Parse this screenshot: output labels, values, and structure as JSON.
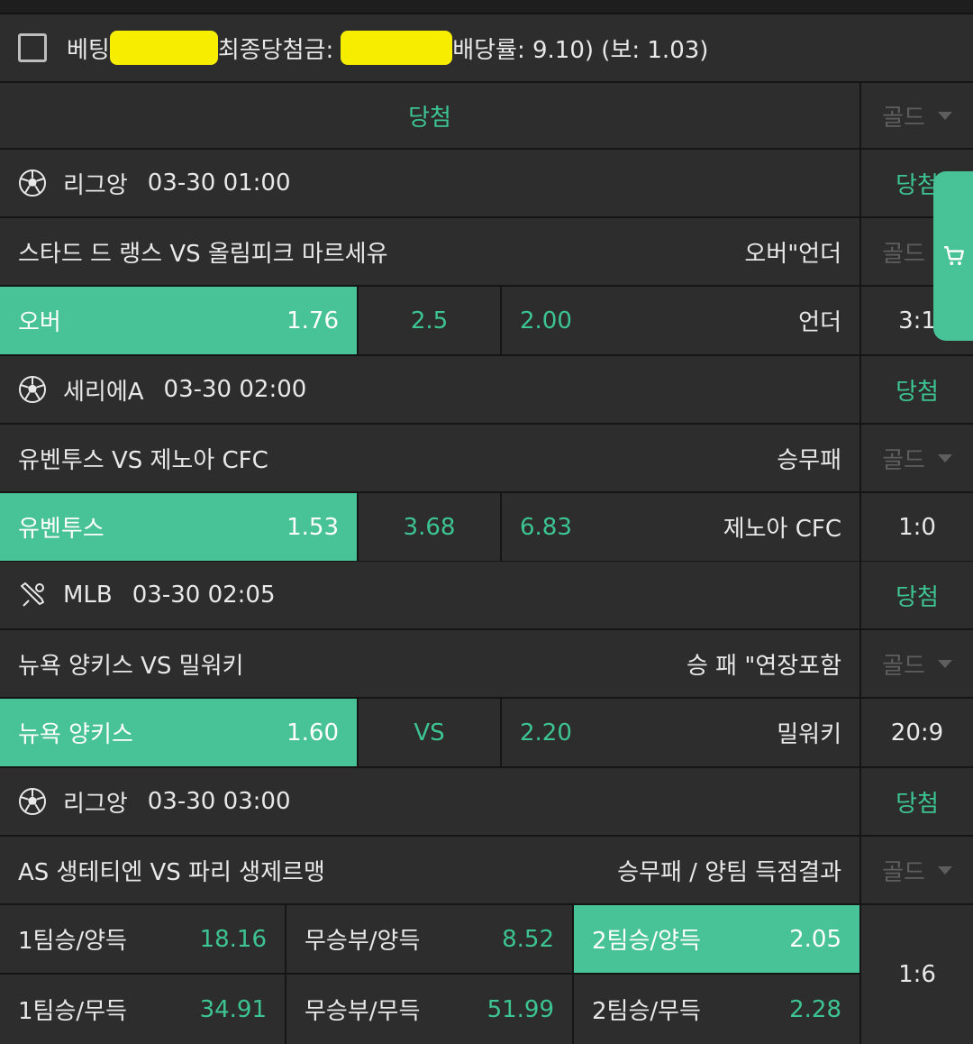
{
  "summary": {
    "bet_label": "베팅",
    "final_label": "최종당첨금:",
    "odds_text": "배당률: 9.10) (보: 1.03)",
    "result": "당첨",
    "grade": "골드"
  },
  "colors": {
    "accent": "#48c297",
    "accent_text": "#3dc493",
    "redaction": "#f7ed00",
    "row_bg": "#2d2d2d"
  },
  "games": [
    {
      "sport_icon": "soccer-ball-icon",
      "league": "리그앙",
      "time": "03-30 01:00",
      "result": "당첨",
      "matchup": "스타드 드 랭스 VS 올림피크 마르세유",
      "market": "오버\"언더",
      "grade": "골드",
      "home_label": "오버",
      "home_odds": "1.76",
      "middle": "2.5",
      "away_odds": "2.00",
      "away_label": "언더",
      "score": "3:1"
    },
    {
      "sport_icon": "soccer-ball-icon",
      "league": "세리에A",
      "time": "03-30 02:00",
      "result": "당첨",
      "matchup": "유벤투스 VS 제노아 CFC",
      "market": "승무패",
      "grade": "골드",
      "home_label": "유벤투스",
      "home_odds": "1.53",
      "middle": "3.68",
      "away_odds": "6.83",
      "away_label": "제노아 CFC",
      "score": "1:0"
    },
    {
      "sport_icon": "baseball-bat-icon",
      "league": "MLB",
      "time": "03-30 02:05",
      "result": "당첨",
      "matchup": "뉴욕 양키스 VS 밀워키",
      "market": "승 패 \"연장포함",
      "grade": "골드",
      "home_label": "뉴욕 양키스",
      "home_odds": "1.60",
      "middle": "VS",
      "away_odds": "2.20",
      "away_label": "밀워키",
      "score": "20:9"
    }
  ],
  "game4": {
    "sport_icon": "soccer-ball-icon",
    "league": "리그앙",
    "time": "03-30 03:00",
    "result": "당첨",
    "matchup": "AS 생테티엔 VS 파리 생제르맹",
    "market": "승무패 / 양팀 득점결과",
    "grade": "골드",
    "options": [
      {
        "label": "1팀승/양득",
        "odds": "18.16"
      },
      {
        "label": "무승부/양득",
        "odds": "8.52"
      },
      {
        "label": "2팀승/양득",
        "odds": "2.05"
      },
      {
        "label": "1팀승/무득",
        "odds": "34.91"
      },
      {
        "label": "무승부/무득",
        "odds": "51.99"
      },
      {
        "label": "2팀승/무득",
        "odds": "2.28"
      }
    ],
    "score": "1:6"
  },
  "cart": {
    "icon": "shopping-cart-icon"
  }
}
